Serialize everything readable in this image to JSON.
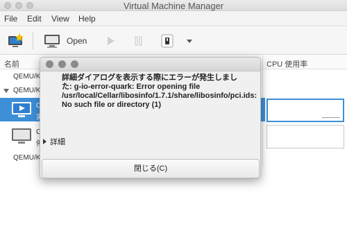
{
  "window": {
    "title": "Virtual Machine Manager"
  },
  "menubar": {
    "items": [
      "File",
      "Edit",
      "View",
      "Help"
    ]
  },
  "toolbar": {
    "open_label": "Open"
  },
  "list": {
    "header_name": "名前",
    "header_cpu": "CPU 使用率",
    "groups": [
      {
        "label": "QEMU/K"
      },
      {
        "label": "QEMU/K"
      }
    ],
    "vm_rows": [
      {
        "name": "C",
        "status": "実"
      },
      {
        "name": "C",
        "status": "停"
      }
    ],
    "footer_label": "QEMU/K"
  },
  "dialog": {
    "message": "詳細ダイアログを表示する際にエラーが発生しました: g-io-error-quark: Error opening file /usr/local/Cellar/libosinfo/1.7.1/share/libosinfo/pci.ids: No such file or directory (1)",
    "expander_label": "詳細",
    "close_button_label": "閉じる(C)"
  },
  "colors": {
    "selection": "#3d8fd8",
    "dialog_bg": "#f0f0f0"
  }
}
